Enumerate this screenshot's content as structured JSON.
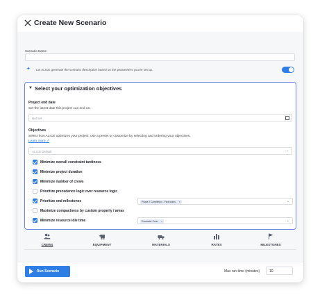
{
  "dialog": {
    "title": "Create New Scenario"
  },
  "scenario_name": {
    "label": "Scenario Name",
    "value": ""
  },
  "alice": {
    "description": "Let ALICE generate the scenario description based on the parameters you've set up.",
    "toggle_on": true
  },
  "objectives_panel": {
    "title": "Select your optimization objectives",
    "project_end": {
      "label": "Project end date",
      "description": "Set the latest date this project can end on.",
      "placeholder": "Not set"
    },
    "objectives": {
      "label": "Objectives",
      "description": "Select how ALICE optimizes your project: use a preset or customize by selecting and ordering your objectives.",
      "learn_more": "Learn more",
      "preset_placeholder": "ALICE Default",
      "items": [
        {
          "label": "Minimize overall constraint tardiness",
          "checked": true
        },
        {
          "label": "Minimize project duration",
          "checked": true
        },
        {
          "label": "Minimize number of crews",
          "checked": true
        },
        {
          "label": "Prioritize precedence logic over resource logic",
          "checked": false
        },
        {
          "label": "Prioritize end milestones",
          "checked": true,
          "tag": "Phase 2 Completion - Park works"
        },
        {
          "label": "Maximize compactness by custom property / areas",
          "checked": false
        },
        {
          "label": "Minimize resource idle time",
          "checked": true,
          "tag": "Excavator Crew"
        }
      ]
    }
  },
  "tabs": [
    {
      "label": "CREWS",
      "icon": "crews-icon",
      "active": true
    },
    {
      "label": "EQUIPMENT",
      "icon": "equipment-icon",
      "active": false
    },
    {
      "label": "MATERIALS",
      "icon": "materials-icon",
      "active": false
    },
    {
      "label": "RATES",
      "icon": "rates-icon",
      "active": false
    },
    {
      "label": "MILESTONES",
      "icon": "milestones-icon",
      "active": false
    }
  ],
  "footer": {
    "run_button": "Run Scenario",
    "max_run_label": "Max run time (minutes)",
    "max_run_value": "10"
  },
  "colors": {
    "accent": "#2f7ee6",
    "panel_border": "#6b84e6"
  }
}
